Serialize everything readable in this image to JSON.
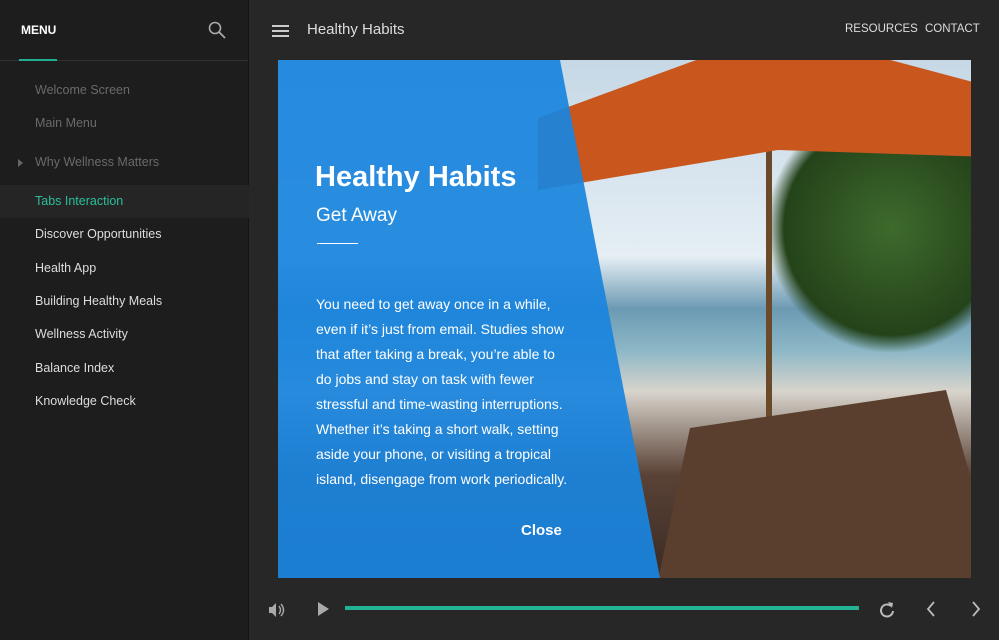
{
  "sidebar": {
    "menu_label": "MENU",
    "items": [
      {
        "label": "Welcome Screen"
      },
      {
        "label": "Main Menu"
      },
      {
        "label": "Why Wellness Matters"
      },
      {
        "label": "Tabs Interaction"
      },
      {
        "label": "Discover Opportunities"
      },
      {
        "label": "Health App"
      },
      {
        "label": "Building Healthy Meals"
      },
      {
        "label": "Wellness Activity"
      },
      {
        "label": "Balance Index"
      },
      {
        "label": "Knowledge Check"
      }
    ]
  },
  "header": {
    "title": "Healthy Habits",
    "links": [
      "RESOURCES",
      "CONTACT"
    ]
  },
  "slide": {
    "title": "Healthy Habits",
    "subtitle": "Get Away",
    "body": "You need to get away once in a while, even if it’s just from email. Studies show that after taking a break, you’re able to do jobs and stay on task with fewer stressful and time-wasting interruptions. Whether it’s taking a short walk, setting aside your phone, or visiting a tropical island, disengage from work periodically.",
    "close": "Close"
  },
  "player": {
    "progress_percent": 100,
    "accent": "#23b394"
  }
}
